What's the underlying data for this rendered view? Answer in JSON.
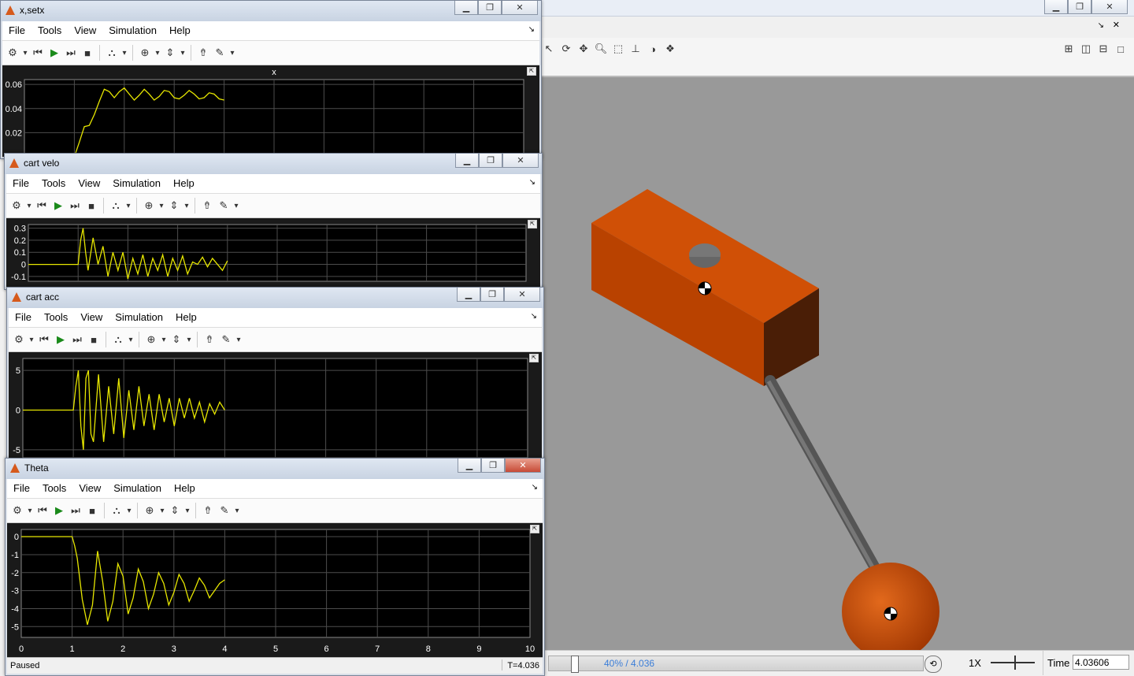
{
  "menu": [
    "File",
    "Tools",
    "View",
    "Simulation",
    "Help"
  ],
  "explorer": {
    "progress": "40% / 4.036",
    "progress_fraction": 0.4,
    "speed": "1X",
    "time_label": "Time",
    "time_value": "4.03606"
  },
  "scopes": [
    {
      "title": "x,setx",
      "plot_title": "x"
    },
    {
      "title": "cart velo",
      "plot_title": ""
    },
    {
      "title": "cart acc",
      "plot_title": ""
    },
    {
      "title": "Theta",
      "plot_title": "",
      "status": "Paused",
      "time": "T=4.036"
    }
  ],
  "chart_data": [
    {
      "type": "line",
      "title": "x",
      "y_ticks": [
        "0.06",
        "0.04",
        "0.02"
      ],
      "xlim": [
        0,
        10
      ],
      "ylim": [
        0,
        0.064
      ],
      "x": [
        1.0,
        1.1,
        1.2,
        1.3,
        1.4,
        1.5,
        1.6,
        1.7,
        1.8,
        1.9,
        2.0,
        2.1,
        2.2,
        2.3,
        2.4,
        2.5,
        2.6,
        2.7,
        2.8,
        2.9,
        3.0,
        3.1,
        3.2,
        3.3,
        3.4,
        3.5,
        3.6,
        3.7,
        3.8,
        3.9,
        4.0
      ],
      "y": [
        0.0,
        0.012,
        0.025,
        0.026,
        0.035,
        0.046,
        0.056,
        0.054,
        0.049,
        0.054,
        0.057,
        0.052,
        0.047,
        0.051,
        0.056,
        0.052,
        0.047,
        0.05,
        0.055,
        0.054,
        0.049,
        0.048,
        0.051,
        0.055,
        0.052,
        0.048,
        0.049,
        0.053,
        0.052,
        0.048,
        0.047
      ]
    },
    {
      "type": "line",
      "y_ticks": [
        "0.3",
        "0.2",
        "0.1",
        "0",
        "-0.1"
      ],
      "xlim": [
        0,
        10
      ],
      "ylim": [
        -0.14,
        0.33
      ],
      "x": [
        0,
        0.5,
        1.0,
        1.05,
        1.1,
        1.15,
        1.2,
        1.3,
        1.4,
        1.5,
        1.6,
        1.7,
        1.8,
        1.9,
        2.0,
        2.1,
        2.2,
        2.3,
        2.4,
        2.5,
        2.6,
        2.7,
        2.8,
        2.9,
        3.0,
        3.1,
        3.2,
        3.3,
        3.4,
        3.5,
        3.6,
        3.7,
        3.8,
        3.9,
        4.0
      ],
      "y": [
        0,
        0,
        0,
        0.2,
        0.3,
        0.1,
        -0.05,
        0.22,
        0.0,
        0.15,
        -0.1,
        0.1,
        -0.05,
        0.1,
        -0.12,
        0.05,
        -0.08,
        0.08,
        -0.1,
        0.05,
        -0.05,
        0.08,
        -0.1,
        0.05,
        -0.05,
        0.07,
        -0.08,
        0.02,
        0.0,
        0.06,
        -0.02,
        0.05,
        0.0,
        -0.05,
        0.03
      ]
    },
    {
      "type": "line",
      "y_ticks": [
        "5",
        "0",
        "-5"
      ],
      "xlim": [
        0,
        10
      ],
      "ylim": [
        -6,
        6.5
      ],
      "x": [
        0,
        0.5,
        1.0,
        1.05,
        1.1,
        1.15,
        1.2,
        1.25,
        1.3,
        1.35,
        1.4,
        1.5,
        1.6,
        1.7,
        1.8,
        1.9,
        2.0,
        2.1,
        2.2,
        2.3,
        2.4,
        2.5,
        2.6,
        2.7,
        2.8,
        2.9,
        3.0,
        3.1,
        3.2,
        3.3,
        3.4,
        3.5,
        3.6,
        3.7,
        3.8,
        3.9,
        4.0
      ],
      "y": [
        0,
        0,
        0,
        3,
        5,
        -2,
        -5,
        4,
        5,
        -3,
        -4,
        4.5,
        -4,
        3,
        -3,
        4,
        -3.5,
        2.5,
        -2.5,
        3,
        -2,
        2,
        -2.5,
        2,
        -1.5,
        1.5,
        -2,
        1.5,
        -1,
        1.5,
        -1,
        1,
        -1.5,
        0.8,
        -0.5,
        1,
        0
      ]
    },
    {
      "type": "line",
      "y_ticks": [
        "0",
        "-1",
        "-2",
        "-3",
        "-4",
        "-5"
      ],
      "x_ticks": [
        "0",
        "1",
        "2",
        "3",
        "4",
        "5",
        "6",
        "7",
        "8",
        "9",
        "10"
      ],
      "xlim": [
        0,
        10
      ],
      "ylim": [
        -5.6,
        0.4
      ],
      "x": [
        0,
        0.5,
        1.0,
        1.05,
        1.1,
        1.2,
        1.3,
        1.4,
        1.5,
        1.6,
        1.7,
        1.8,
        1.9,
        2.0,
        2.1,
        2.2,
        2.3,
        2.4,
        2.5,
        2.6,
        2.7,
        2.8,
        2.9,
        3.0,
        3.1,
        3.2,
        3.3,
        3.4,
        3.5,
        3.6,
        3.7,
        3.8,
        3.9,
        4.0
      ],
      "y": [
        0,
        0,
        0,
        -0.5,
        -1.2,
        -3.5,
        -4.9,
        -3.8,
        -0.8,
        -2.5,
        -4.7,
        -3.6,
        -1.5,
        -2.2,
        -4.3,
        -3.4,
        -1.8,
        -2.5,
        -4.0,
        -3.2,
        -2.0,
        -2.6,
        -3.8,
        -3.1,
        -2.1,
        -2.6,
        -3.6,
        -3.0,
        -2.3,
        -2.7,
        -3.4,
        -3.0,
        -2.6,
        -2.4
      ]
    }
  ],
  "colors": {
    "trace": "#e6e600",
    "plot_bg": "#1a1a1a",
    "scene_bg": "#999999",
    "body": "#c24a0a",
    "accent": "#3a7dd8"
  }
}
